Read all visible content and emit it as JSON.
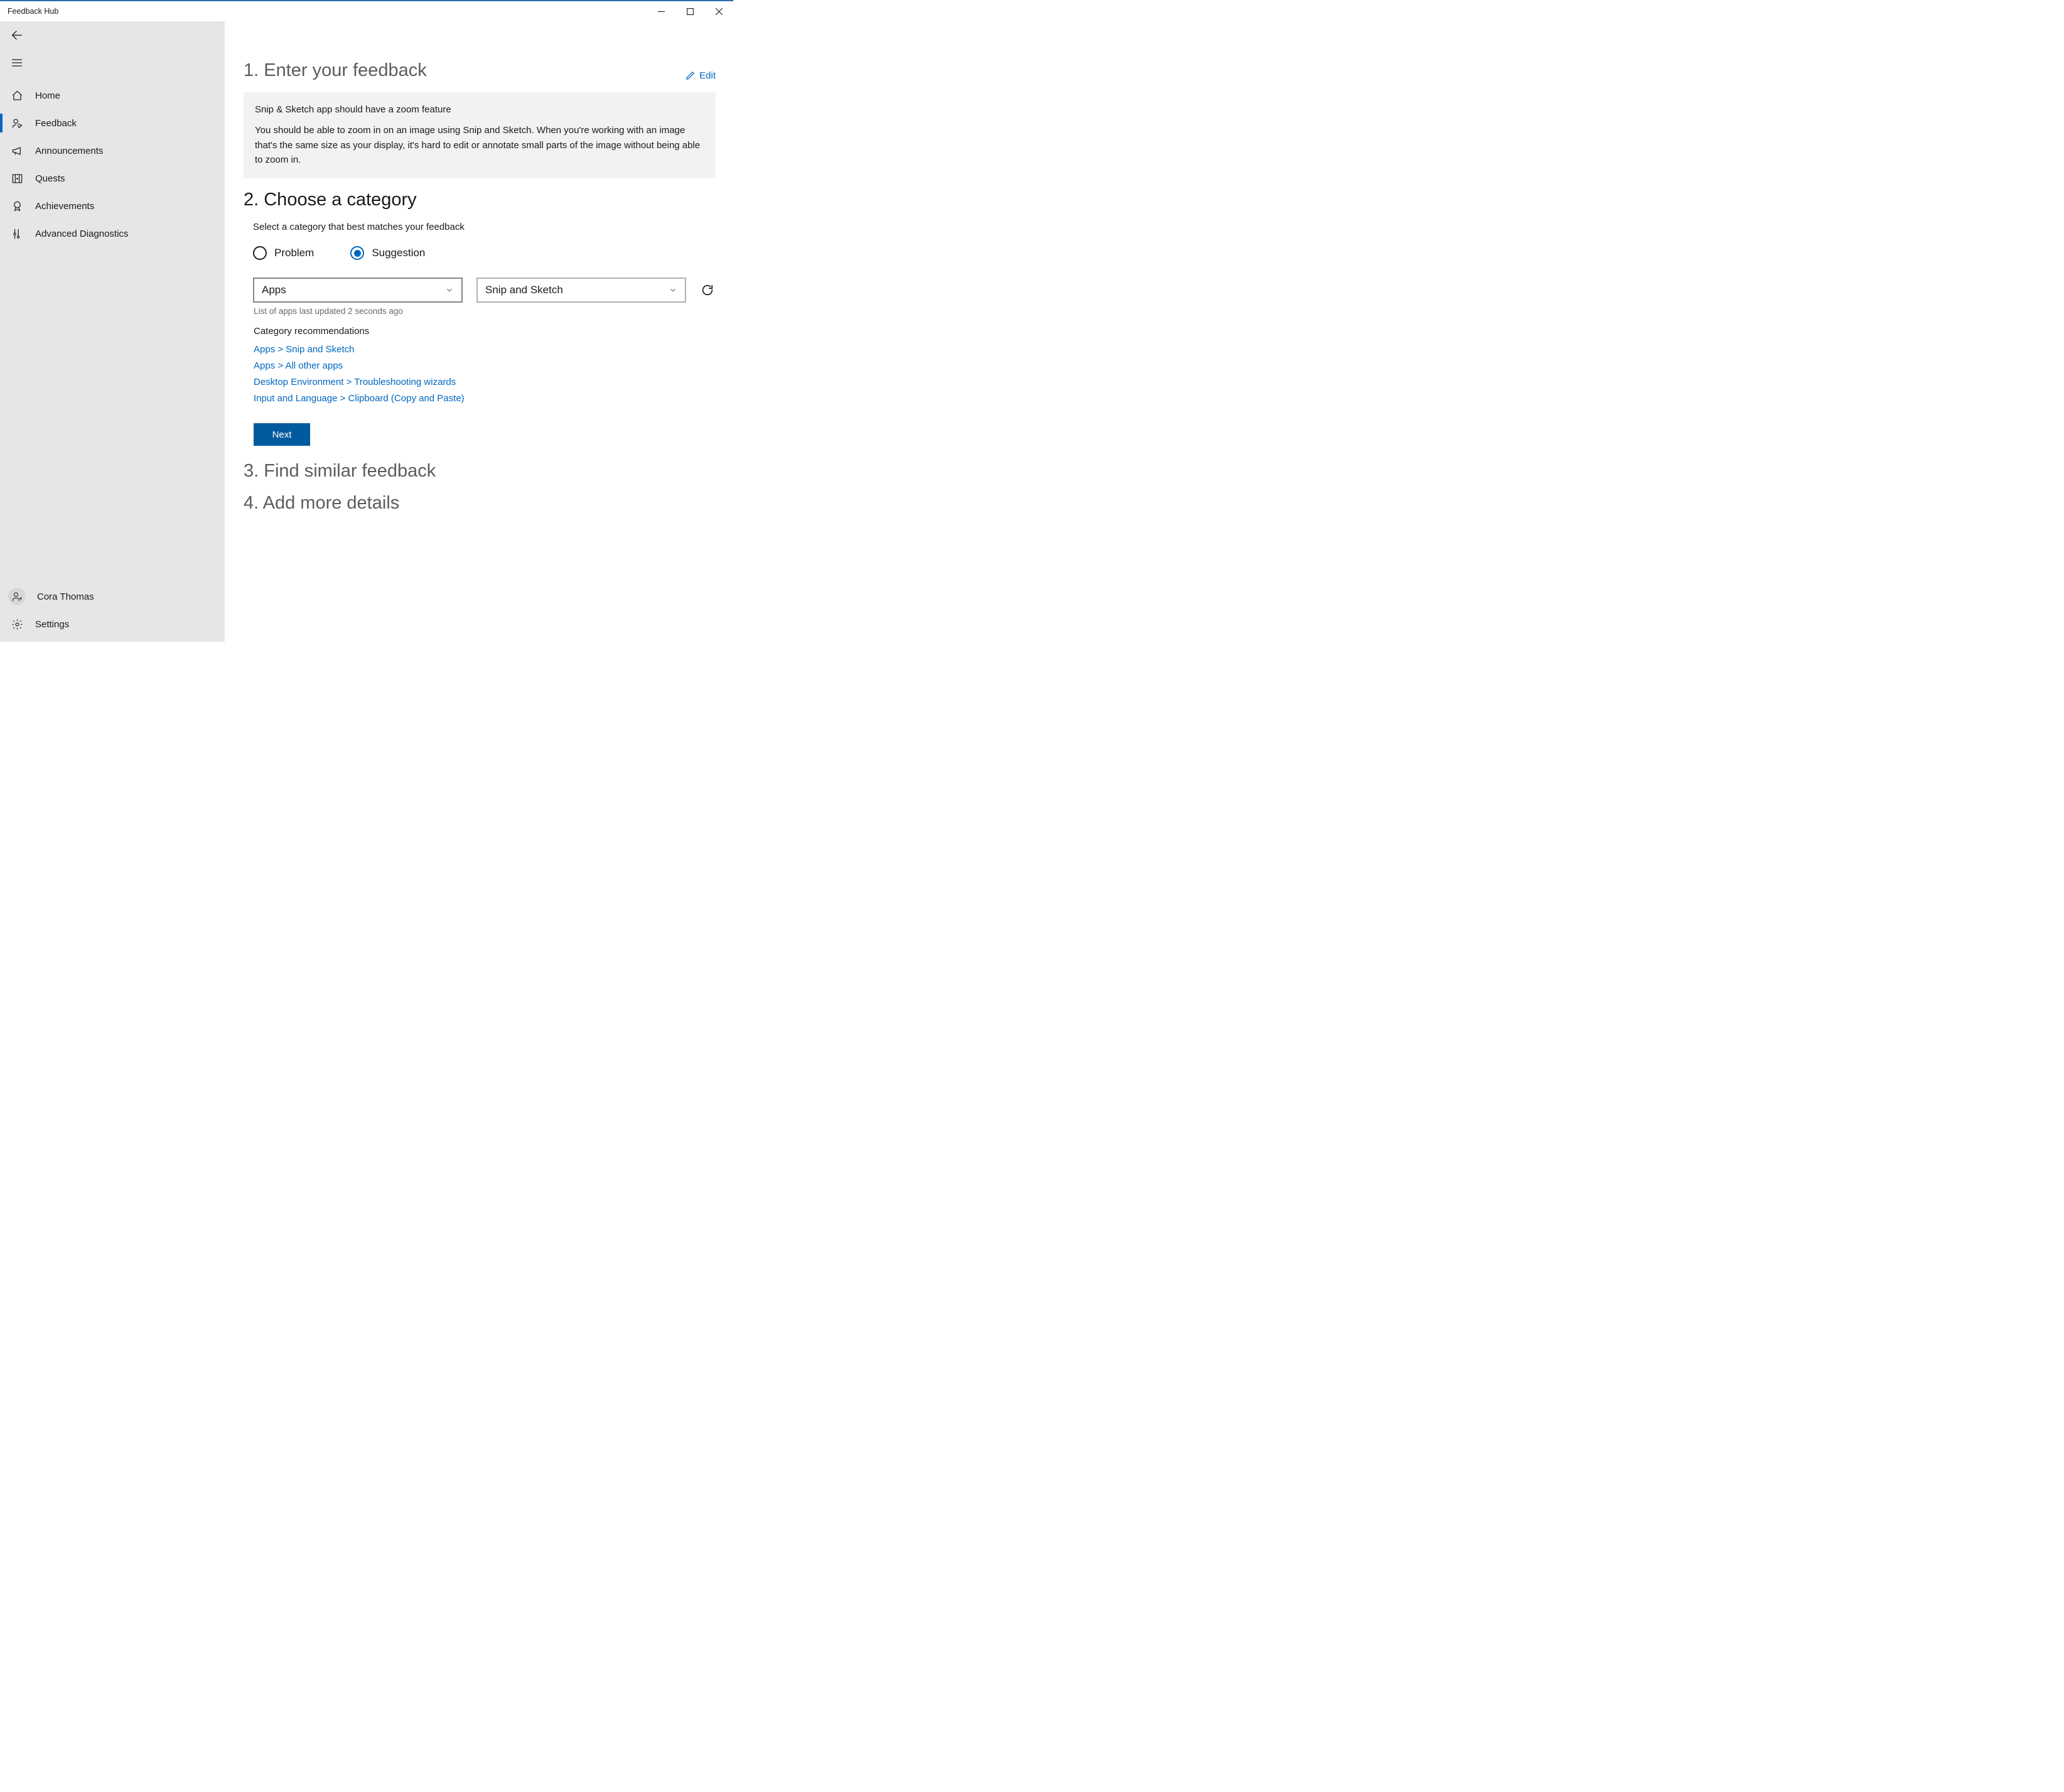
{
  "window": {
    "title": "Feedback Hub"
  },
  "sidebar": {
    "items": [
      {
        "key": "home",
        "label": "Home"
      },
      {
        "key": "feedback",
        "label": "Feedback",
        "active": true
      },
      {
        "key": "announcements",
        "label": "Announcements"
      },
      {
        "key": "quests",
        "label": "Quests"
      },
      {
        "key": "achievements",
        "label": "Achievements"
      },
      {
        "key": "diagnostics",
        "label": "Advanced Diagnostics"
      }
    ],
    "user": {
      "name": "Cora Thomas"
    },
    "settings_label": "Settings"
  },
  "steps": {
    "s1_title": "1. Enter your feedback",
    "s2_title": "2. Choose a category",
    "s3_title": "3. Find similar feedback",
    "s4_title": "4. Add more details"
  },
  "edit_label": "Edit",
  "feedback": {
    "title": "Snip & Sketch app should have a zoom feature",
    "body": "You should be able to zoom in on an image using Snip and Sketch. When you're working with an image that's the same size as your display, it's hard to edit or annotate small parts of the image without being able to zoom in."
  },
  "category": {
    "note": "Select a category that best matches your feedback",
    "radios": {
      "problem": "Problem",
      "suggestion": "Suggestion",
      "selected": "suggestion"
    },
    "dropdowns": {
      "primary": "Apps",
      "secondary": "Snip and Sketch"
    },
    "hint": "List of apps last updated 2 seconds ago",
    "rec_title": "Category recommendations",
    "recs": [
      "Apps > Snip and Sketch",
      "Apps > All other apps",
      "Desktop Environment > Troubleshooting wizards",
      "Input and Language > Clipboard (Copy and Paste)"
    ],
    "next_label": "Next"
  }
}
